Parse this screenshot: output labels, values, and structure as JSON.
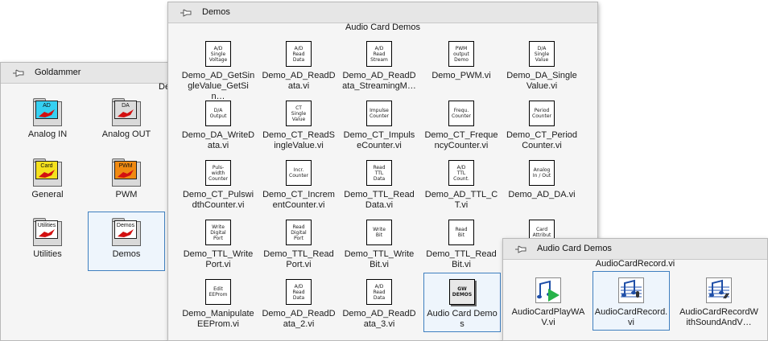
{
  "goldammer": {
    "title": "Goldammer",
    "subtitle_partial": "De",
    "items": [
      {
        "label": "Analog IN",
        "icon": "AD",
        "color": "#35d0f2"
      },
      {
        "label": "Analog OUT",
        "icon": "DA",
        "color": "#dcdcdc"
      },
      {
        "label": "General",
        "icon": "Card",
        "color": "#f5e11d"
      },
      {
        "label": "PWM",
        "icon": "PWM",
        "color": "#f08a12"
      },
      {
        "label": "Utilities",
        "icon": "Utilities",
        "color": "#ffffff"
      },
      {
        "label": "Demos",
        "icon": "Demos",
        "color": "#ffffff"
      }
    ]
  },
  "demos": {
    "title": "Demos",
    "subtitle": "Audio Card Demos",
    "items": [
      {
        "icon": "A/D\nSingle\nVoltage",
        "label": "Demo_AD_GetSingleValue_GetSin…"
      },
      {
        "icon": "A/D\nRead\nData",
        "label": "Demo_AD_ReadData.vi"
      },
      {
        "icon": "A/D\nRead\nStream",
        "label": "Demo_AD_ReadData_StreamingM…"
      },
      {
        "icon": "PWM\noutput\nDemo",
        "label": "Demo_PWM.vi"
      },
      {
        "icon": "D/A\nSingle\nValue",
        "label": "Demo_DA_SingleValue.vi"
      },
      {
        "icon": "D/A\nOutput",
        "label": "Demo_DA_WriteData.vi"
      },
      {
        "icon": "CT\nSingle\nValue",
        "label": "Demo_CT_ReadSingleValue.vi"
      },
      {
        "icon": "Impulse\nCounter",
        "label": "Demo_CT_ImpulseCounter.vi"
      },
      {
        "icon": "Frequ.\nCounter",
        "label": "Demo_CT_FrequencyCounter.vi"
      },
      {
        "icon": "Period\nCounter",
        "label": "Demo_CT_PeriodCounter.vi"
      },
      {
        "icon": "Puls-\nwidth\nCounter",
        "label": "Demo_CT_PulswidthCounter.vi"
      },
      {
        "icon": "Incr.\nCounter",
        "label": "Demo_CT_IncrementCounter.vi"
      },
      {
        "icon": "Read\nTTL\nData",
        "label": "Demo_TTL_ReadData.vi"
      },
      {
        "icon": "A/D\nTTL\nCount.",
        "label": "Demo_AD_TTL_CT.vi"
      },
      {
        "icon": "Analog\nIn / Out",
        "label": "Demo_AD_DA.vi"
      },
      {
        "icon": "Write\nDigital\nPort",
        "label": "Demo_TTL_WritePort.vi"
      },
      {
        "icon": "Read\nDigital\nPort",
        "label": "Demo_TTL_ReadPort.vi"
      },
      {
        "icon": "Write\nBit",
        "label": "Demo_TTL_WriteBit.vi"
      },
      {
        "icon": "Read\nBit",
        "label": "Demo_TTL_ReadBit.vi"
      },
      {
        "icon": "Card\nAttribut",
        "label": ""
      },
      {
        "icon": "Edit\nEEProm",
        "label": "Demo_ManipulateEEProm.vi"
      },
      {
        "icon": "A/D\nRead\nData",
        "label": "Demo_AD_ReadData_2.vi"
      },
      {
        "icon": "A/D\nRead\nData",
        "label": "Demo_AD_ReadData_3.vi"
      },
      {
        "icon": "GW\nDEMOS",
        "label": "Audio Card Demos"
      }
    ]
  },
  "audio": {
    "title": "Audio Card Demos",
    "subtitle": "AudioCardRecord.vi",
    "items": [
      {
        "label": "AudioCardPlayWAV.vi",
        "icon": "audio-play-icon"
      },
      {
        "label": "AudioCardRecord.vi",
        "icon": "audio-record-icon"
      },
      {
        "label": "AudioCardRecordWithSoundAndV…",
        "icon": "audio-record-sound-icon"
      }
    ]
  }
}
